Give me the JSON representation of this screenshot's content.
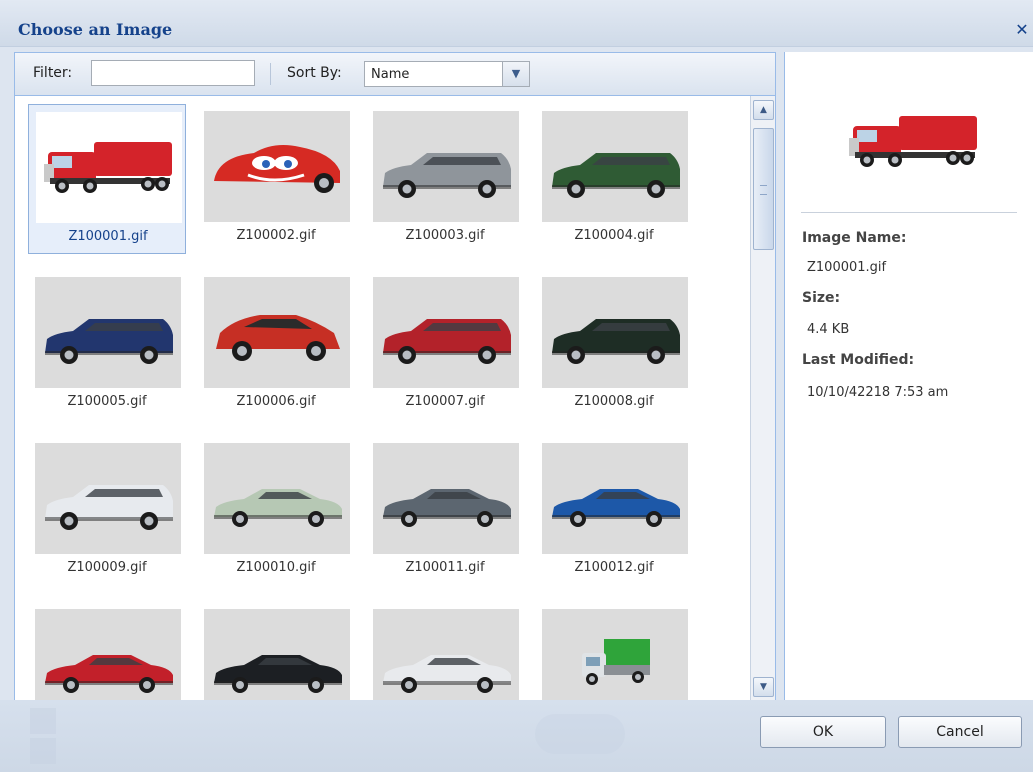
{
  "dialog": {
    "title": "Choose an Image",
    "close_glyph": "✕"
  },
  "toolbar": {
    "filter_label": "Filter:",
    "filter_value": "",
    "sort_label": "Sort By:",
    "sort_value": "Name"
  },
  "images": [
    {
      "name": "Z100001.gif",
      "kind": "truck",
      "color": "#d4232a",
      "selected": true
    },
    {
      "name": "Z100002.gif",
      "kind": "racecar",
      "color": "#d62a23"
    },
    {
      "name": "Z100003.gif",
      "kind": "wagon",
      "color": "#8f959b"
    },
    {
      "name": "Z100004.gif",
      "kind": "wagon",
      "color": "#2f5b34"
    },
    {
      "name": "Z100005.gif",
      "kind": "wagon",
      "color": "#22366e"
    },
    {
      "name": "Z100006.gif",
      "kind": "hatch",
      "color": "#c62f24"
    },
    {
      "name": "Z100007.gif",
      "kind": "wagon",
      "color": "#b3222a"
    },
    {
      "name": "Z100008.gif",
      "kind": "wagon",
      "color": "#1e2d25"
    },
    {
      "name": "Z100009.gif",
      "kind": "wagon",
      "color": "#e7eaee"
    },
    {
      "name": "Z100010.gif",
      "kind": "sedan",
      "color": "#b6c8b4"
    },
    {
      "name": "Z100011.gif",
      "kind": "sedan",
      "color": "#5c6670"
    },
    {
      "name": "Z100012.gif",
      "kind": "sedan",
      "color": "#1d58a8"
    },
    {
      "name": "",
      "kind": "sedan",
      "color": "#c2202a"
    },
    {
      "name": "",
      "kind": "sedan",
      "color": "#1c1f23"
    },
    {
      "name": "",
      "kind": "sedan",
      "color": "#e8eaed"
    },
    {
      "name": "",
      "kind": "minitruck",
      "color": "#2fa43a"
    }
  ],
  "details": {
    "name_label": "Image Name:",
    "name_value": "Z100001.gif",
    "size_label": "Size:",
    "size_value": "4.4 KB",
    "modified_label": "Last Modified:",
    "modified_value": "10/10/42218 7:53 am"
  },
  "buttons": {
    "ok": "OK",
    "cancel": "Cancel"
  }
}
